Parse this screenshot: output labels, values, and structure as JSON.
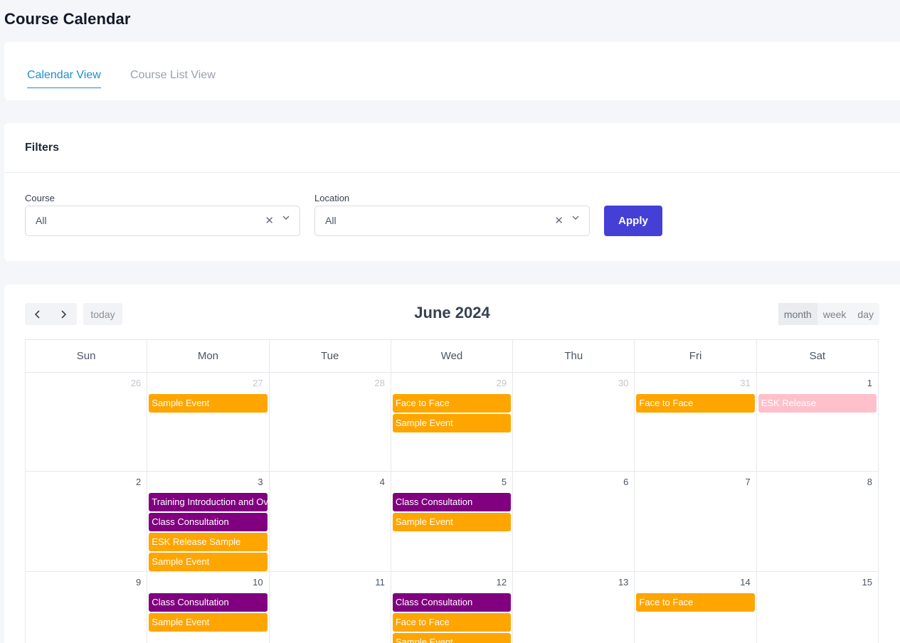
{
  "page": {
    "title": "Course Calendar"
  },
  "tabs": [
    {
      "label": "Calendar View",
      "active": true
    },
    {
      "label": "Course List View",
      "active": false
    }
  ],
  "filters": {
    "title": "Filters",
    "course": {
      "label": "Course",
      "value": "All"
    },
    "location": {
      "label": "Location",
      "value": "All"
    },
    "apply_label": "Apply"
  },
  "calendar": {
    "title": "June 2024",
    "today_label": "today",
    "views": [
      {
        "label": "month",
        "active": true
      },
      {
        "label": "week",
        "active": false
      },
      {
        "label": "day",
        "active": false
      }
    ],
    "weekdays": [
      "Sun",
      "Mon",
      "Tue",
      "Wed",
      "Thu",
      "Fri",
      "Sat"
    ],
    "weeks": [
      [
        {
          "day": "26",
          "other": true,
          "events": []
        },
        {
          "day": "27",
          "other": true,
          "events": [
            {
              "title": "Sample Event",
              "color": "orange"
            }
          ]
        },
        {
          "day": "28",
          "other": true,
          "events": []
        },
        {
          "day": "29",
          "other": true,
          "events": [
            {
              "title": "Face to Face",
              "color": "orange"
            },
            {
              "title": "Sample Event",
              "color": "orange"
            }
          ]
        },
        {
          "day": "30",
          "other": true,
          "events": []
        },
        {
          "day": "31",
          "other": true,
          "events": [
            {
              "title": "Face to Face",
              "color": "orange"
            }
          ]
        },
        {
          "day": "1",
          "other": false,
          "events": [
            {
              "title": "ESK Release",
              "color": "pink"
            }
          ]
        }
      ],
      [
        {
          "day": "2",
          "other": false,
          "events": []
        },
        {
          "day": "3",
          "other": false,
          "events": [
            {
              "title": "Training Introduction and Overview",
              "color": "purple"
            },
            {
              "title": "Class Consultation",
              "color": "purple"
            },
            {
              "title": "ESK Release Sample",
              "color": "orange"
            },
            {
              "title": "Sample Event",
              "color": "orange"
            }
          ]
        },
        {
          "day": "4",
          "other": false,
          "events": []
        },
        {
          "day": "5",
          "other": false,
          "events": [
            {
              "title": "Class Consultation",
              "color": "purple"
            },
            {
              "title": "Sample Event",
              "color": "orange"
            }
          ]
        },
        {
          "day": "6",
          "other": false,
          "events": []
        },
        {
          "day": "7",
          "other": false,
          "events": []
        },
        {
          "day": "8",
          "other": false,
          "events": []
        }
      ],
      [
        {
          "day": "9",
          "other": false,
          "events": []
        },
        {
          "day": "10",
          "other": false,
          "events": [
            {
              "title": "Class Consultation",
              "color": "purple"
            },
            {
              "title": "Sample Event",
              "color": "orange"
            }
          ]
        },
        {
          "day": "11",
          "other": false,
          "events": []
        },
        {
          "day": "12",
          "other": false,
          "events": [
            {
              "title": "Class Consultation",
              "color": "purple"
            },
            {
              "title": "Face to Face",
              "color": "orange"
            },
            {
              "title": "Sample Event",
              "color": "orange"
            }
          ]
        },
        {
          "day": "13",
          "other": false,
          "events": []
        },
        {
          "day": "14",
          "other": false,
          "events": [
            {
              "title": "Face to Face",
              "color": "orange"
            }
          ]
        },
        {
          "day": "15",
          "other": false,
          "events": []
        }
      ]
    ]
  },
  "colors": {
    "accent": "#1d8ecf",
    "apply": "#4440d6",
    "orange": "#ffa500",
    "purple": "#800080",
    "pink": "#ffc0cb"
  }
}
